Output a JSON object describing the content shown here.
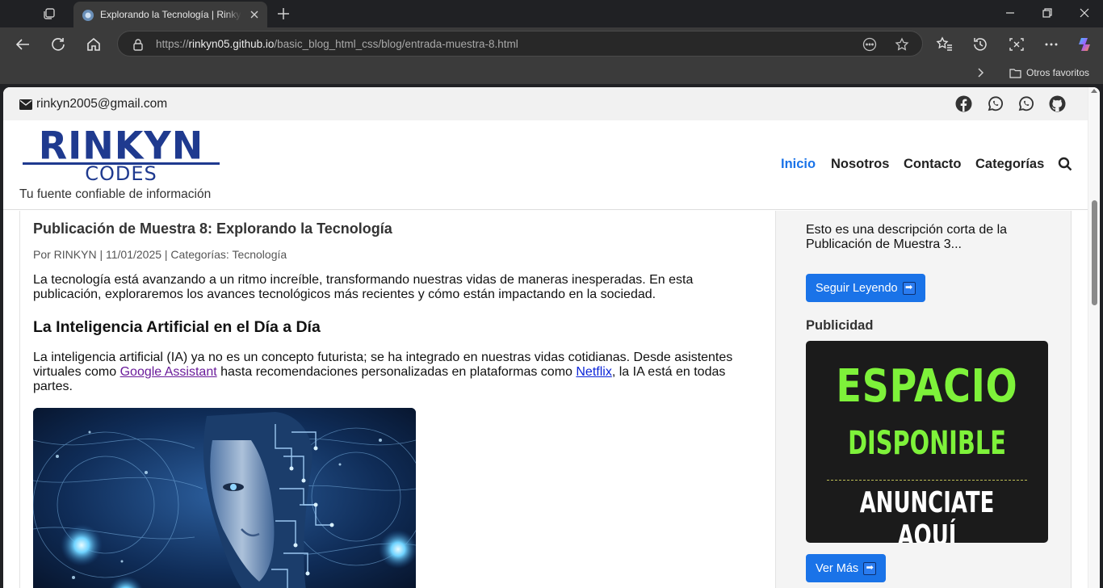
{
  "browser": {
    "tab_title": "Explorando la Tecnología | Rinkyn Codes",
    "url_prefix": "https://",
    "url_domain": "rinkyn05.github.io",
    "url_path": "/basic_blog_html_css/blog/entrada-muestra-8.html",
    "favorites_folder": "Otros favoritos"
  },
  "site": {
    "email": "rinkyn2005@gmail.com",
    "logo_main": "RINKYN",
    "logo_sub": "CODES",
    "tagline": "Tu fuente confiable de información",
    "brand_color": "#1f3a8f",
    "accent_color": "#1a73e8",
    "nav": [
      "Inicio",
      "Nosotros",
      "Contacto",
      "Categorías"
    ],
    "social_icons": [
      "facebook-icon",
      "whatsapp-icon",
      "whatsapp-icon",
      "github-icon"
    ]
  },
  "post": {
    "title": "Publicación de Muestra 8: Explorando la Tecnología",
    "meta": "Por RINKYN | 11/01/2025 | Categorías: Tecnología",
    "intro": "La tecnología está avanzando a un ritmo increíble, transformando nuestras vidas de maneras inesperadas. En esta publicación, exploraremos los avances tecnológicos más recientes y cómo están impactando en la sociedad.",
    "section_heading": "La Inteligencia Artificial en el Día a Día",
    "section_text_1": "La inteligencia artificial (IA) ya no es un concepto futurista; se ha integrado en nuestras vidas cotidianas. Desde asistentes virtuales como ",
    "link_1": "Google Assistant",
    "section_text_2": " hasta recomendaciones personalizadas en plataformas como ",
    "link_2": "Netflix",
    "section_text_3": ", la IA está en todas partes."
  },
  "sidebar": {
    "description": "Esto es una descripción corta de la Publicación de Muestra 3...",
    "read_more": "Seguir Leyendo",
    "ads_heading": "Publicidad",
    "ad_line1": "ESPACIO",
    "ad_line2": "DISPONIBLE",
    "ad_line3": "ANUNCIATE AQUÍ",
    "see_more": "Ver Más"
  }
}
